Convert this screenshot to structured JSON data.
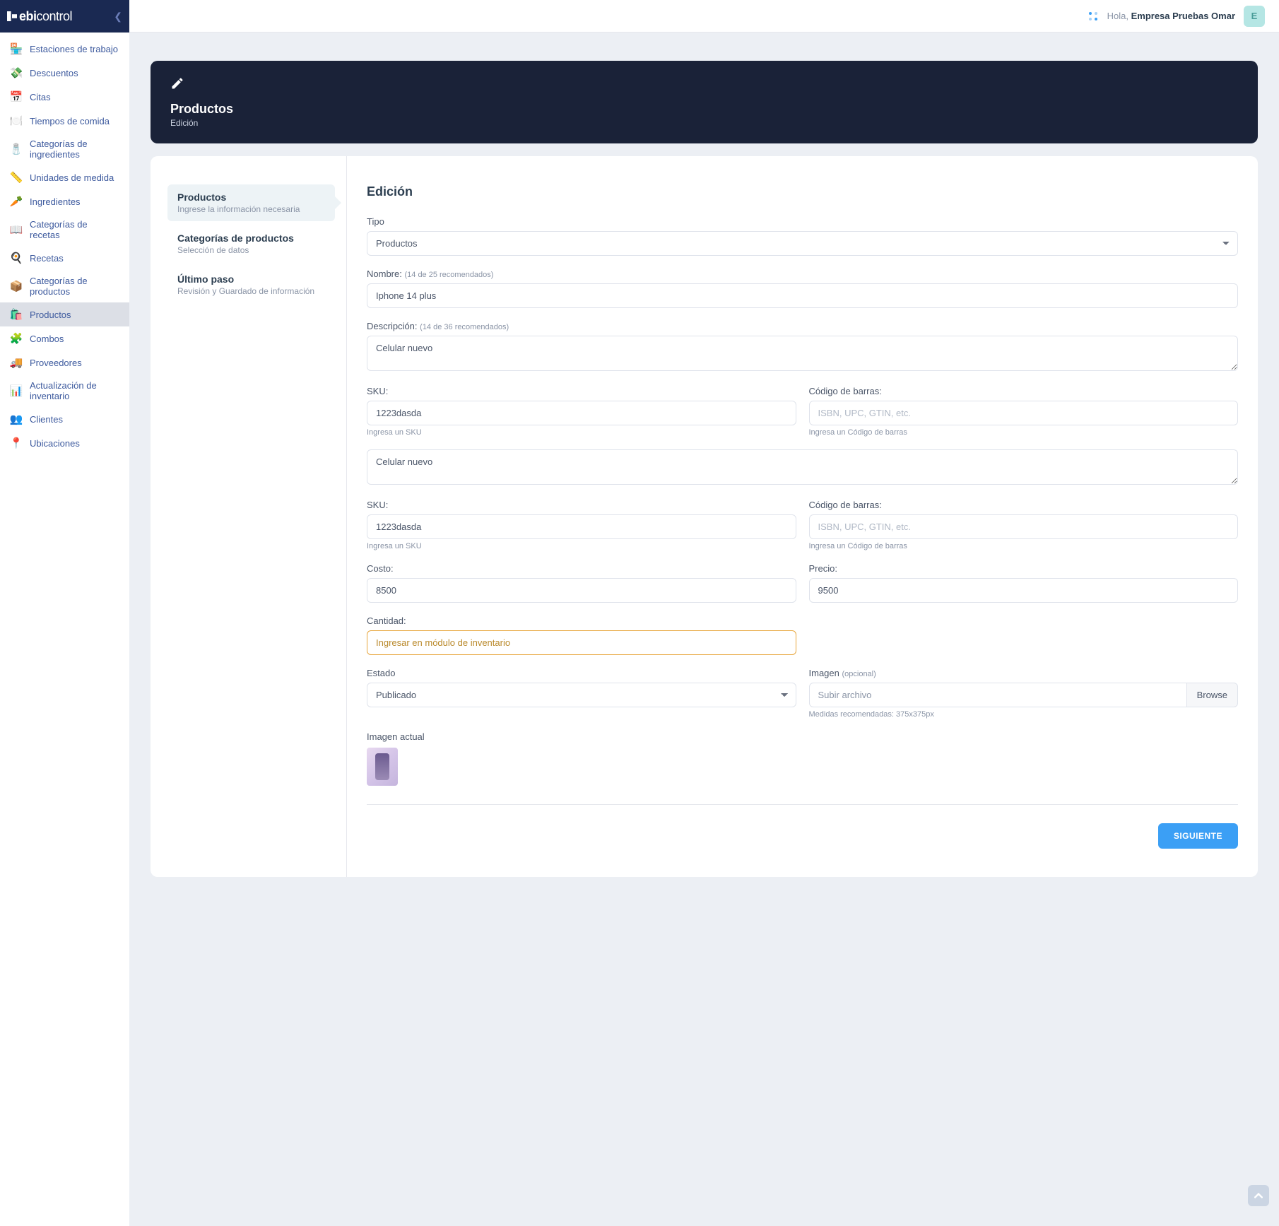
{
  "brand": {
    "name_bold": "ebi",
    "name_rest": "control"
  },
  "sidebar": {
    "items": [
      {
        "icon": "🏪",
        "label": "Estaciones de trabajo"
      },
      {
        "icon": "💸",
        "label": "Descuentos"
      },
      {
        "icon": "📅",
        "label": "Citas"
      },
      {
        "icon": "🍽️",
        "label": "Tiempos de comida"
      },
      {
        "icon": "🧂",
        "label": "Categorías de ingredientes"
      },
      {
        "icon": "📏",
        "label": "Unidades de medida"
      },
      {
        "icon": "🥕",
        "label": "Ingredientes"
      },
      {
        "icon": "📖",
        "label": "Categorías de recetas"
      },
      {
        "icon": "🍳",
        "label": "Recetas"
      },
      {
        "icon": "📦",
        "label": "Categorías de productos"
      },
      {
        "icon": "🛍️",
        "label": "Productos"
      },
      {
        "icon": "🧩",
        "label": "Combos"
      },
      {
        "icon": "🚚",
        "label": "Proveedores"
      },
      {
        "icon": "📊",
        "label": "Actualización de inventario"
      },
      {
        "icon": "👥",
        "label": "Clientes"
      },
      {
        "icon": "📍",
        "label": "Ubicaciones"
      }
    ],
    "active_index": 10
  },
  "topbar": {
    "greeting_prefix": "Hola, ",
    "greeting_name": "Empresa Pruebas Omar",
    "avatar_initial": "E"
  },
  "banner": {
    "title": "Productos",
    "subtitle": "Edición"
  },
  "steps": [
    {
      "title": "Productos",
      "sub": "Ingrese la información necesaria"
    },
    {
      "title": "Categorías de productos",
      "sub": "Selección de datos"
    },
    {
      "title": "Último paso",
      "sub": "Revisión y Guardado de información"
    }
  ],
  "steps_active": 0,
  "form": {
    "section_title": "Edición",
    "tipo": {
      "label": "Tipo",
      "value": "Productos"
    },
    "nombre": {
      "label": "Nombre:",
      "hint": "(14 de 25 recomendados)",
      "value": "Iphone 14 plus"
    },
    "descripcion": {
      "label": "Descripción:",
      "hint": "(14 de 36 recomendados)",
      "value": "Celular nuevo"
    },
    "sku": {
      "label": "SKU:",
      "value": "1223dasda",
      "helper": "Ingresa un SKU"
    },
    "barcode": {
      "label": "Código de barras:",
      "placeholder": "ISBN, UPC, GTIN, etc.",
      "helper": "Ingresa un Código de barras"
    },
    "descripcion2_value": "Celular nuevo",
    "sku2": {
      "label": "SKU:",
      "value": "1223dasda",
      "helper": "Ingresa un SKU"
    },
    "barcode2": {
      "label": "Código de barras:",
      "placeholder": "ISBN, UPC, GTIN, etc.",
      "helper": "Ingresa un Código de barras"
    },
    "costo": {
      "label": "Costo:",
      "value": "8500"
    },
    "precio": {
      "label": "Precio:",
      "value": "9500"
    },
    "cantidad": {
      "label": "Cantidad:",
      "value": "Ingresar en módulo de inventario"
    },
    "estado": {
      "label": "Estado",
      "value": "Publicado"
    },
    "imagen": {
      "label_pre": "Imagen ",
      "label_opt": "(opcional)",
      "placeholder": "Subir archivo",
      "browse": "Browse",
      "helper": "Medidas recomendadas: 375x375px"
    },
    "imagen_actual_label": "Imagen actual",
    "submit": "SIGUIENTE"
  }
}
